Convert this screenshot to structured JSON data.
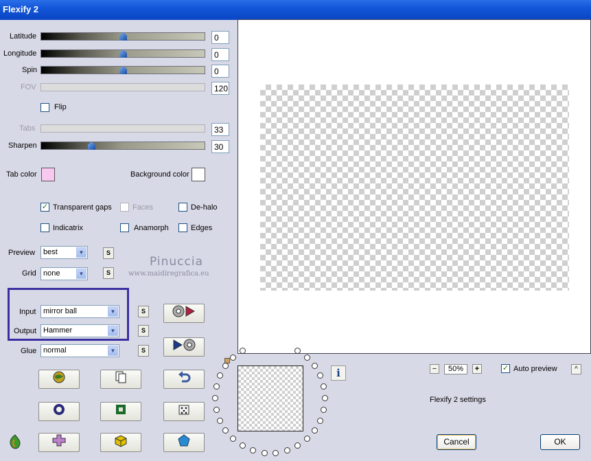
{
  "window": {
    "title": "Flexify 2"
  },
  "sliders": {
    "latitude": {
      "label": "Latitude",
      "value": "0",
      "level": 0.5
    },
    "longitude": {
      "label": "Longitude",
      "value": "0",
      "level": 0.5
    },
    "spin": {
      "label": "Spin",
      "value": "0",
      "level": 0.5
    },
    "fov": {
      "label": "FOV",
      "value": "120",
      "enabled": false
    },
    "tabs": {
      "label": "Tabs",
      "value": "33",
      "enabled": false
    },
    "sharpen": {
      "label": "Sharpen",
      "value": "30",
      "level": 0.3
    }
  },
  "flip": {
    "label": "Flip",
    "checked": false
  },
  "colors": {
    "tab_color": {
      "label": "Tab color",
      "color": "#f8c8f0"
    },
    "background_color": {
      "label": "Background color",
      "color": "#ffffff"
    }
  },
  "options": {
    "transparent_gaps": {
      "label": "Transparent gaps",
      "checked": true,
      "check": "✓"
    },
    "faces": {
      "label": "Faces",
      "checked": false,
      "enabled": false
    },
    "de_halo": {
      "label": "De-halo",
      "checked": false
    },
    "indicatrix": {
      "label": "Indicatrix",
      "checked": false
    },
    "anamorph": {
      "label": "Anamorph",
      "checked": false
    },
    "edges": {
      "label": "Edges",
      "checked": false
    }
  },
  "selects": {
    "preview": {
      "label": "Preview",
      "value": "best"
    },
    "grid": {
      "label": "Grid",
      "value": "none"
    },
    "input": {
      "label": "Input",
      "value": "mirror ball"
    },
    "output": {
      "label": "Output",
      "value": "Hammer"
    },
    "glue": {
      "label": "Glue",
      "value": "normal"
    }
  },
  "small_button_label": "S",
  "watermark": {
    "name": "Pinuccia",
    "url": "www.maidiregrafica.eu"
  },
  "zoom": {
    "minus": "−",
    "value": "50%",
    "plus": "+"
  },
  "auto_preview": {
    "label": "Auto preview",
    "checked": true,
    "check": "✓"
  },
  "collapse_button": "^",
  "settings_label": "Flexify 2 settings",
  "buttons": {
    "cancel": "Cancel",
    "ok": "OK"
  },
  "info_button": "i",
  "accent": {
    "highlight_border": "#3a2fa0",
    "title_bar": "#0a45c4"
  }
}
